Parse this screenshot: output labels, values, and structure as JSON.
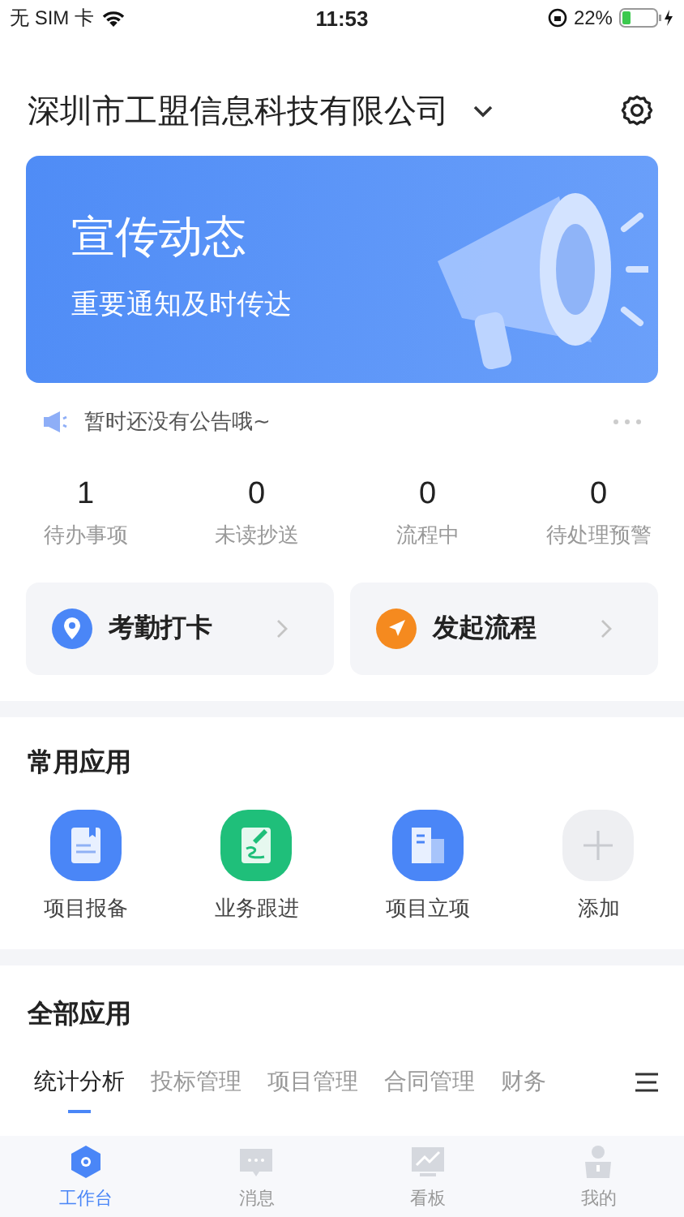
{
  "status_bar": {
    "carrier": "无 SIM 卡",
    "time": "11:53",
    "battery": "22%"
  },
  "header": {
    "company": "深圳市工盟信息科技有限公司"
  },
  "banner": {
    "title": "宣传动态",
    "subtitle": "重要通知及时传达"
  },
  "notice": {
    "text": "暂时还没有公告哦~"
  },
  "stats": [
    {
      "value": "1",
      "label": "待办事项"
    },
    {
      "value": "0",
      "label": "未读抄送"
    },
    {
      "value": "0",
      "label": "流程中"
    },
    {
      "value": "0",
      "label": "待处理预警"
    }
  ],
  "shortcuts": [
    {
      "label": "考勤打卡",
      "kind": "location"
    },
    {
      "label": "发起流程",
      "kind": "send"
    }
  ],
  "common_apps": {
    "title": "常用应用",
    "items": [
      {
        "label": "项目报备",
        "kind": "report"
      },
      {
        "label": "业务跟进",
        "kind": "follow"
      },
      {
        "label": "项目立项",
        "kind": "building"
      },
      {
        "label": "添加",
        "kind": "add"
      }
    ]
  },
  "all_apps": {
    "title": "全部应用",
    "tabs": [
      {
        "label": "统计分析",
        "selected": true
      },
      {
        "label": "投标管理",
        "selected": false
      },
      {
        "label": "项目管理",
        "selected": false
      },
      {
        "label": "合同管理",
        "selected": false
      },
      {
        "label": "财务",
        "selected": false
      }
    ]
  },
  "tab_bar": [
    {
      "label": "工作台",
      "kind": "workbench",
      "selected": true
    },
    {
      "label": "消息",
      "kind": "message",
      "selected": false
    },
    {
      "label": "看板",
      "kind": "board",
      "selected": false
    },
    {
      "label": "我的",
      "kind": "me",
      "selected": false
    }
  ]
}
